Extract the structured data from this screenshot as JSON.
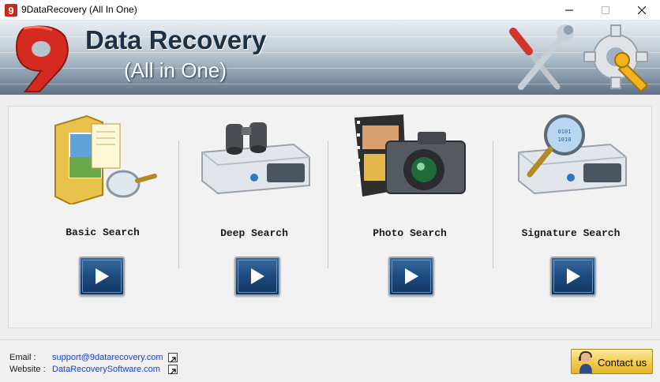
{
  "window": {
    "title": "9DataRecovery (All In One)"
  },
  "banner": {
    "title": "Data Recovery",
    "subtitle": "(All in One)",
    "logo_char": "9"
  },
  "options": [
    {
      "label": "Basic Search",
      "icon": "folder-magnifier-icon"
    },
    {
      "label": "Deep Search",
      "icon": "drive-binoculars-icon"
    },
    {
      "label": "Photo Search",
      "icon": "camera-film-icon"
    },
    {
      "label": "Signature Search",
      "icon": "drive-magnifier-icon"
    }
  ],
  "footer": {
    "email_label": "Email :",
    "email_value": "support@9datarecovery.com",
    "website_label": "Website :",
    "website_value": "DataRecoverySoftware.com",
    "contact_label": "Contact us"
  },
  "colors": {
    "accent_red": "#d42a20",
    "banner_text": "#1a3146",
    "link": "#1a3fd0",
    "play_button": "#1d4b80",
    "contact_button": "#f2cd52"
  }
}
